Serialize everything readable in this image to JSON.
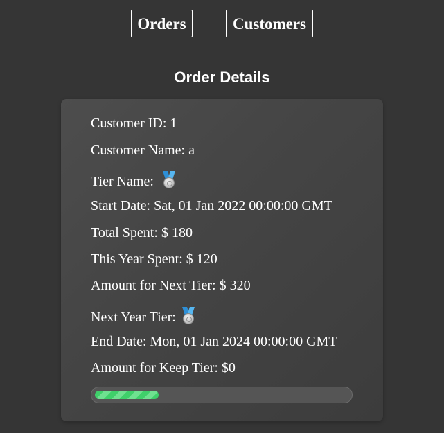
{
  "nav": {
    "orders_label": "Orders",
    "customers_label": "Customers"
  },
  "page": {
    "title": "Order Details"
  },
  "details": {
    "customer_id_label": "Customer ID:",
    "customer_id": "1",
    "customer_name_label": "Customer Name:",
    "customer_name": "a",
    "tier_name_label": "Tier Name:",
    "tier_icon": "silver-medal-icon",
    "start_date_label": "Start Date:",
    "start_date": "Sat, 01 Jan 2022 00:00:00 GMT",
    "total_spent_label": "Total Spent:",
    "total_spent": "$ 180",
    "this_year_spent_label": "This Year Spent:",
    "this_year_spent": "$ 120",
    "amount_next_tier_label": "Amount for Next Tier:",
    "amount_next_tier": "$ 320",
    "next_year_tier_label": "Next Year Tier:",
    "next_year_tier_icon": "silver-medal-icon",
    "end_date_label": "End Date:",
    "end_date": "Mon, 01 Jan 2024 00:00:00 GMT",
    "amount_keep_tier_label": "Amount for Keep Tier:",
    "amount_keep_tier": "$0"
  },
  "progress": {
    "fraction": 0.25,
    "fill_color": "#3fcf6a"
  }
}
